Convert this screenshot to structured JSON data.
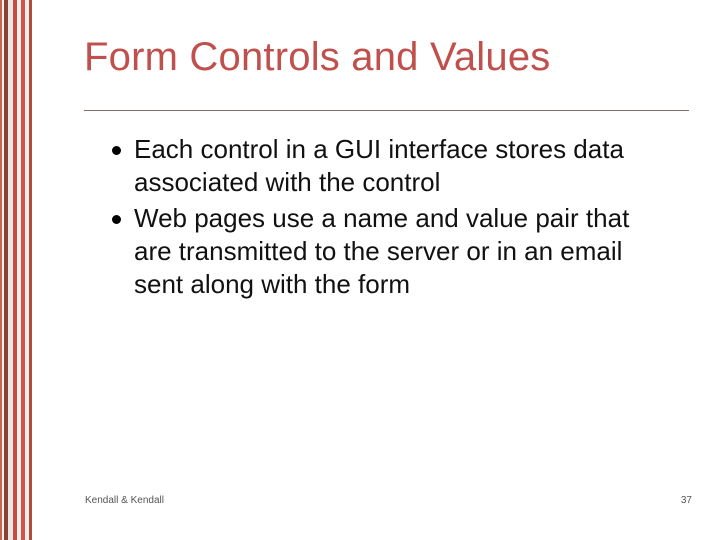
{
  "slide": {
    "title": "Form Controls and Values",
    "bullets": [
      "Each control in a GUI interface stores data associated with the control",
      "Web pages use a name and value pair that are transmitted to the server or in an email sent along with the form"
    ],
    "footer_left": "Kendall & Kendall",
    "page_number": "37"
  },
  "colors": {
    "title": "#c0504d",
    "rule": "#7d7168"
  }
}
